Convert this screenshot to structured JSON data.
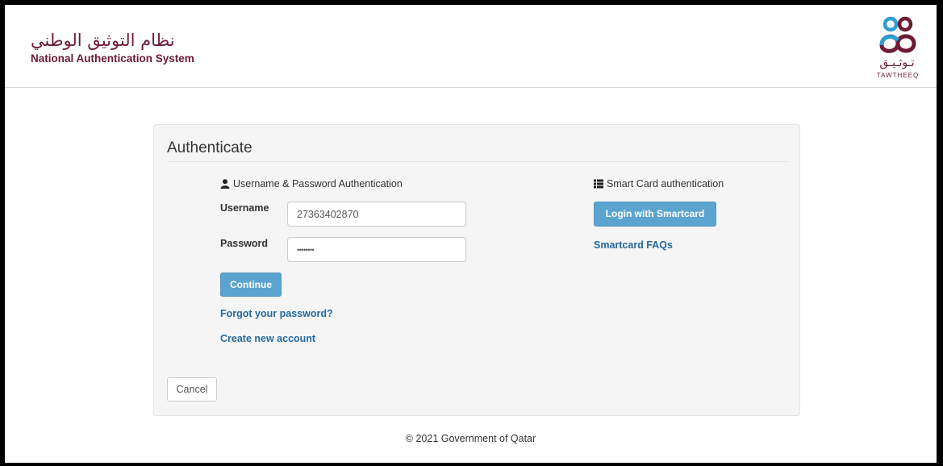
{
  "header": {
    "title_ar": "نظام التوثيق الوطني",
    "title_en": "National Authentication System",
    "logo_ar": "تـوثـيـق",
    "logo_en": "TAWTHEEQ",
    "logo_icon": "tawtheeq-logo-icon",
    "brand_color": "#6c1b34",
    "logo_accent": "#2a9fd6"
  },
  "panel": {
    "title": "Authenticate",
    "password_section": {
      "icon": "user-icon",
      "heading": "Username & Password Authentication",
      "username_label": "Username",
      "username_value": "27363402870",
      "password_label": "Password",
      "password_value": "••••••••",
      "continue_label": "Continue",
      "forgot_label": "Forgot your password?",
      "create_label": "Create new account"
    },
    "smartcard_section": {
      "icon": "list-icon",
      "heading": "Smart Card authentication",
      "login_label": "Login with Smartcard",
      "faq_label": "Smartcard FAQs"
    },
    "cancel_label": "Cancel"
  },
  "footer": {
    "text": "© 2021 Government of Qatar"
  },
  "colors": {
    "button_blue": "#5ba4cf",
    "link_blue": "#23699e",
    "panel_bg": "#f5f5f5"
  }
}
